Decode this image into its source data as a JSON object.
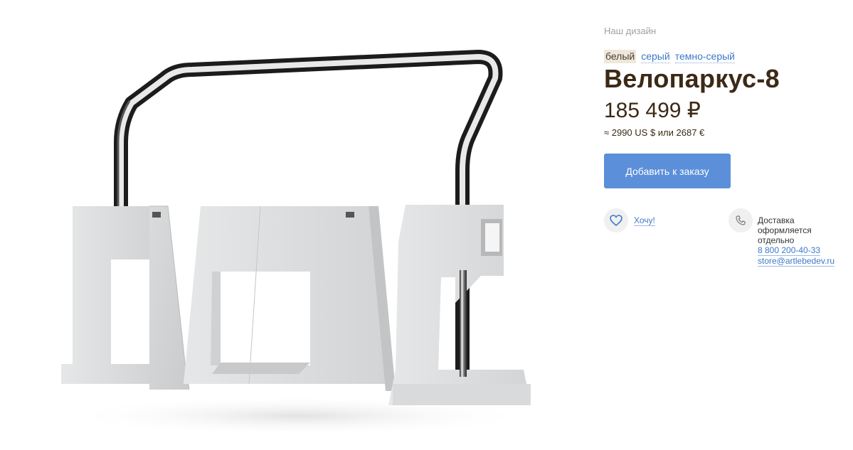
{
  "product": {
    "collection_label": "Наш дизайн",
    "colors": [
      {
        "label": "белый",
        "active": true
      },
      {
        "label": "серый",
        "active": false
      },
      {
        "label": "темно-серый",
        "active": false
      }
    ],
    "title": "Велопаркус-8",
    "price": "185 499 ₽",
    "price_alt": "≈ 2990 US $ или 2687 €",
    "add_to_order_label": "Добавить к заказу"
  },
  "wishlist": {
    "label": "Хочу!",
    "icon": "heart-icon"
  },
  "delivery": {
    "icon": "phone-icon",
    "note": "Доставка оформляется отдельно",
    "phone": "8 800 200-40-33",
    "email": "store@artlebedev.ru"
  },
  "colors": {
    "accent": "#5b8fd9",
    "link": "#3d79c7",
    "title": "#3c2a16",
    "muted": "#a69f9a",
    "concrete": "#d4d6d7"
  }
}
